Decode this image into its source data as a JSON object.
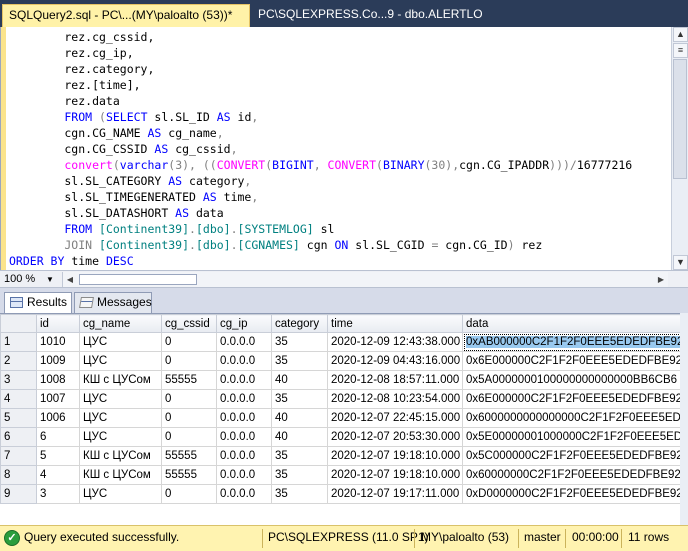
{
  "tabs": [
    {
      "label": "SQLQuery2.sql - PC\\...(MY\\paloalto (53))*",
      "active": true
    },
    {
      "label": "PC\\SQLEXPRESS.Co...9 - dbo.ALERTLOG",
      "active": false
    }
  ],
  "editor": {
    "lines": [
      [
        {
          "t": "        rez.cg_cssid,",
          "c": ""
        }
      ],
      [
        {
          "t": "        rez.cg_ip,",
          "c": ""
        }
      ],
      [
        {
          "t": "        rez.category,",
          "c": ""
        }
      ],
      [
        {
          "t": "        rez.[time],",
          "c": ""
        }
      ],
      [
        {
          "t": "        rez.data",
          "c": ""
        }
      ],
      [
        {
          "t": "        FROM ",
          "c": "k"
        },
        {
          "t": "(",
          "c": "g"
        },
        {
          "t": "SELECT ",
          "c": "k"
        },
        {
          "t": "sl.SL_ID ",
          "c": ""
        },
        {
          "t": "AS ",
          "c": "k"
        },
        {
          "t": "id",
          "c": ""
        },
        {
          "t": ",",
          "c": "g"
        }
      ],
      [
        {
          "t": "        cgn.CG_NAME ",
          "c": ""
        },
        {
          "t": "AS ",
          "c": "k"
        },
        {
          "t": "cg_name",
          "c": ""
        },
        {
          "t": ",",
          "c": "g"
        }
      ],
      [
        {
          "t": "        cgn.CG_CSSID ",
          "c": ""
        },
        {
          "t": "AS ",
          "c": "k"
        },
        {
          "t": "cg_cssid",
          "c": ""
        },
        {
          "t": ",",
          "c": "g"
        }
      ],
      [
        {
          "t": "        convert",
          "c": "f"
        },
        {
          "t": "(",
          "c": "g"
        },
        {
          "t": "varchar",
          "c": "k"
        },
        {
          "t": "(3), ((",
          "c": "g"
        },
        {
          "t": "CONVERT",
          "c": "f"
        },
        {
          "t": "(",
          "c": "g"
        },
        {
          "t": "BIGINT",
          "c": "k"
        },
        {
          "t": ", ",
          "c": "g"
        },
        {
          "t": "CONVERT",
          "c": "f"
        },
        {
          "t": "(",
          "c": "g"
        },
        {
          "t": "BINARY",
          "c": "k"
        },
        {
          "t": "(30),",
          "c": "g"
        },
        {
          "t": "cgn.CG_IPADDR",
          "c": ""
        },
        {
          "t": ")))/",
          "c": "g"
        },
        {
          "t": "16777216",
          "c": ""
        }
      ],
      [
        {
          "t": "        sl.SL_CATEGORY ",
          "c": ""
        },
        {
          "t": "AS ",
          "c": "k"
        },
        {
          "t": "category",
          "c": ""
        },
        {
          "t": ",",
          "c": "g"
        }
      ],
      [
        {
          "t": "        sl.SL_TIMEGENERATED ",
          "c": ""
        },
        {
          "t": "AS ",
          "c": "k"
        },
        {
          "t": "time",
          "c": ""
        },
        {
          "t": ",",
          "c": "g"
        }
      ],
      [
        {
          "t": "        sl.SL_DATASHORT ",
          "c": ""
        },
        {
          "t": "AS ",
          "c": "k"
        },
        {
          "t": "data",
          "c": ""
        }
      ],
      [
        {
          "t": "        FROM ",
          "c": "k"
        },
        {
          "t": "[Continent39]",
          "c": "t"
        },
        {
          "t": ".",
          "c": "g"
        },
        {
          "t": "[dbo]",
          "c": "t"
        },
        {
          "t": ".",
          "c": "g"
        },
        {
          "t": "[SYSTEMLOG] ",
          "c": "t"
        },
        {
          "t": "sl",
          "c": ""
        }
      ],
      [
        {
          "t": "        JOIN ",
          "c": "g"
        },
        {
          "t": "[Continent39]",
          "c": "t"
        },
        {
          "t": ".",
          "c": "g"
        },
        {
          "t": "[dbo]",
          "c": "t"
        },
        {
          "t": ".",
          "c": "g"
        },
        {
          "t": "[CGNAMES] ",
          "c": "t"
        },
        {
          "t": "cgn ",
          "c": ""
        },
        {
          "t": "ON ",
          "c": "k"
        },
        {
          "t": "sl.SL_CGID ",
          "c": ""
        },
        {
          "t": "= ",
          "c": "g"
        },
        {
          "t": "cgn.CG_ID",
          "c": ""
        },
        {
          "t": ") ",
          "c": "g"
        },
        {
          "t": "rez",
          "c": ""
        }
      ],
      [
        {
          "t": "ORDER BY ",
          "c": "k"
        },
        {
          "t": "time ",
          "c": ""
        },
        {
          "t": "DESC",
          "c": "k"
        }
      ]
    ]
  },
  "zoom": {
    "value": "100 %"
  },
  "result_tabs": {
    "results": "Results",
    "messages": "Messages"
  },
  "grid": {
    "columns": [
      "",
      "id",
      "cg_name",
      "cg_cssid",
      "cg_ip",
      "category",
      "time",
      "data"
    ],
    "rows": [
      [
        "1",
        "1010",
        "ЦУС",
        "0",
        "0.0.0.0",
        "35",
        "2020-12-09 12:43:38.000",
        "0xAB000000C2F1F2F0EEE5EDEDFBE92"
      ],
      [
        "2",
        "1009",
        "ЦУС",
        "0",
        "0.0.0.0",
        "35",
        "2020-12-09 04:43:16.000",
        "0x6E000000C2F1F2F0EEE5EDEDFBE92"
      ],
      [
        "3",
        "1008",
        "КШ с ЦУСом",
        "55555",
        "0.0.0.0",
        "40",
        "2020-12-08 18:57:11.000",
        "0x5A0000000100000000000000BB6CB6"
      ],
      [
        "4",
        "1007",
        "ЦУС",
        "0",
        "0.0.0.0",
        "35",
        "2020-12-08 10:23:54.000",
        "0x6E000000C2F1F2F0EEE5EDEDFBE92"
      ],
      [
        "5",
        "1006",
        "ЦУС",
        "0",
        "0.0.0.0",
        "40",
        "2020-12-07 22:45:15.000",
        "0x6000000000000000C2F1F2F0EEE5ED"
      ],
      [
        "6",
        "6",
        "ЦУС",
        "0",
        "0.0.0.0",
        "40",
        "2020-12-07 20:53:30.000",
        "0x5E00000001000000C2F1F2F0EEE5ED"
      ],
      [
        "7",
        "5",
        "КШ с ЦУСом",
        "55555",
        "0.0.0.0",
        "35",
        "2020-12-07 19:18:10.000",
        "0x5C000000C2F1F2F0EEE5EDEDFBE92"
      ],
      [
        "8",
        "4",
        "КШ с ЦУСом",
        "55555",
        "0.0.0.0",
        "35",
        "2020-12-07 19:18:10.000",
        "0x60000000C2F1F2F0EEE5EDEDFBE92"
      ],
      [
        "9",
        "3",
        "ЦУС",
        "0",
        "0.0.0.0",
        "35",
        "2020-12-07 19:17:11.000",
        "0xD0000000C2F1F2F0EEE5EDEDFBE92"
      ]
    ]
  },
  "status": {
    "message": "Query executed successfully.",
    "server": "PC\\SQLEXPRESS (11.0 SP1)",
    "user": "MY\\paloalto (53)",
    "database": "master",
    "elapsed": "00:00:00",
    "rows": "11 rows"
  },
  "colors": {
    "status_bg": "#fff3b0",
    "tabbar_bg": "#2b3c59",
    "active_tab_bg": "#fff2a8",
    "keyword": "#0000ff",
    "function": "#ff00ff",
    "object": "#008080",
    "operator": "#808080"
  }
}
